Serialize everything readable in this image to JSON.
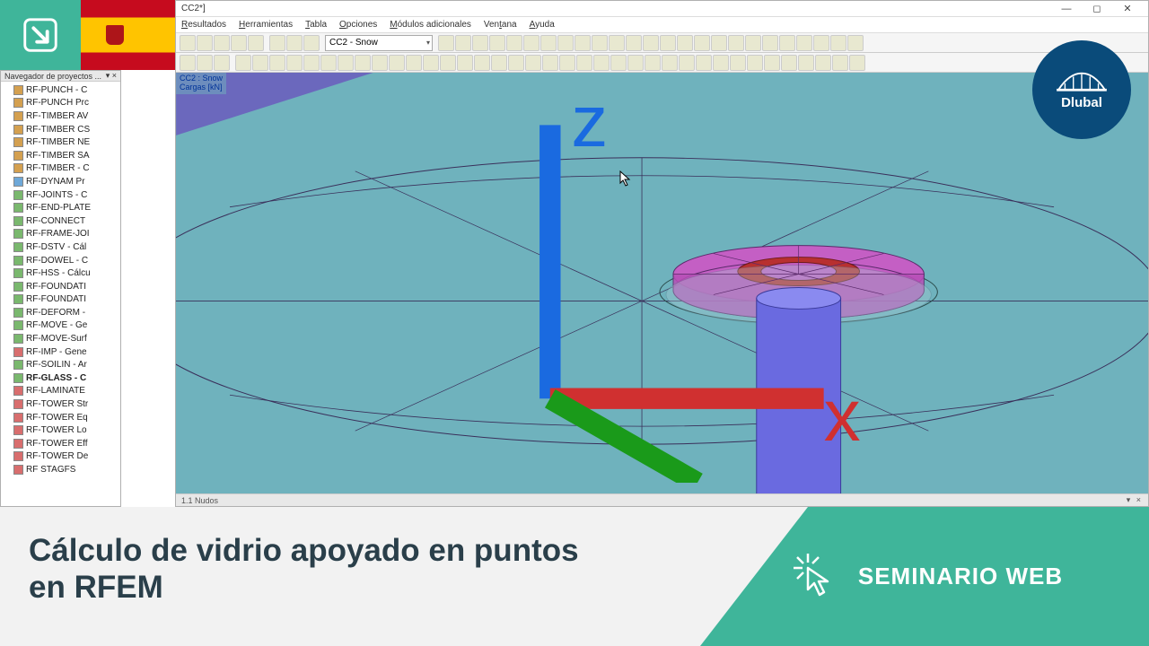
{
  "window": {
    "title": "CC2*]"
  },
  "menu": {
    "resultados": "Resultados",
    "herramientas": "Herramientas",
    "tabla": "Tabla",
    "opciones": "Opciones",
    "modulos": "Módulos adicionales",
    "ventana": "Ventana",
    "ayuda": "Ayuda"
  },
  "toolbar": {
    "combo_value": "CC2 - Snow"
  },
  "viewport": {
    "case_title": "CC2 : Snow",
    "case_sub": "Cargas [kN]"
  },
  "navigator": {
    "title": "Navegador de proyectos ...",
    "pin": "▾ ×",
    "items": [
      {
        "label": "RF-PUNCH - C",
        "cls": ""
      },
      {
        "label": "RF-PUNCH Prc",
        "cls": ""
      },
      {
        "label": "RF-TIMBER AV",
        "cls": ""
      },
      {
        "label": "RF-TIMBER CS",
        "cls": ""
      },
      {
        "label": "RF-TIMBER NE",
        "cls": ""
      },
      {
        "label": "RF-TIMBER SA",
        "cls": ""
      },
      {
        "label": "RF-TIMBER - C",
        "cls": ""
      },
      {
        "label": "RF-DYNAM Pr",
        "cls": "b"
      },
      {
        "label": "RF-JOINTS - C",
        "cls": "g"
      },
      {
        "label": "RF-END-PLATE",
        "cls": "g"
      },
      {
        "label": "RF-CONNECT",
        "cls": "g"
      },
      {
        "label": "RF-FRAME-JOI",
        "cls": "g"
      },
      {
        "label": "RF-DSTV - Cál",
        "cls": "g"
      },
      {
        "label": "RF-DOWEL - C",
        "cls": "g"
      },
      {
        "label": "RF-HSS - Cálcu",
        "cls": "g"
      },
      {
        "label": "RF-FOUNDATI",
        "cls": "g"
      },
      {
        "label": "RF-FOUNDATI",
        "cls": "g"
      },
      {
        "label": "RF-DEFORM -",
        "cls": "g"
      },
      {
        "label": "RF-MOVE - Ge",
        "cls": "g"
      },
      {
        "label": "RF-MOVE-Surf",
        "cls": "g"
      },
      {
        "label": "RF-IMP - Gene",
        "cls": "r"
      },
      {
        "label": "RF-SOILIN - Ar",
        "cls": "g"
      },
      {
        "label": "RF-GLASS - C",
        "cls": "g",
        "bold": true
      },
      {
        "label": "RF-LAMINATE",
        "cls": "r"
      },
      {
        "label": "RF-TOWER Str",
        "cls": "r"
      },
      {
        "label": "RF-TOWER Eq",
        "cls": "r"
      },
      {
        "label": "RF-TOWER Lo",
        "cls": "r"
      },
      {
        "label": "RF-TOWER Eff",
        "cls": "r"
      },
      {
        "label": "RF-TOWER De",
        "cls": "r"
      },
      {
        "label": "RF STAGFS",
        "cls": "r"
      }
    ]
  },
  "bottom_tab": {
    "label": "1.1 Nudos"
  },
  "banner": {
    "title_line1": "Cálculo de vidrio apoyado en puntos",
    "title_line2": "en RFEM",
    "right_label": "SEMINARIO WEB"
  },
  "brand": {
    "name": "Dlubal"
  }
}
